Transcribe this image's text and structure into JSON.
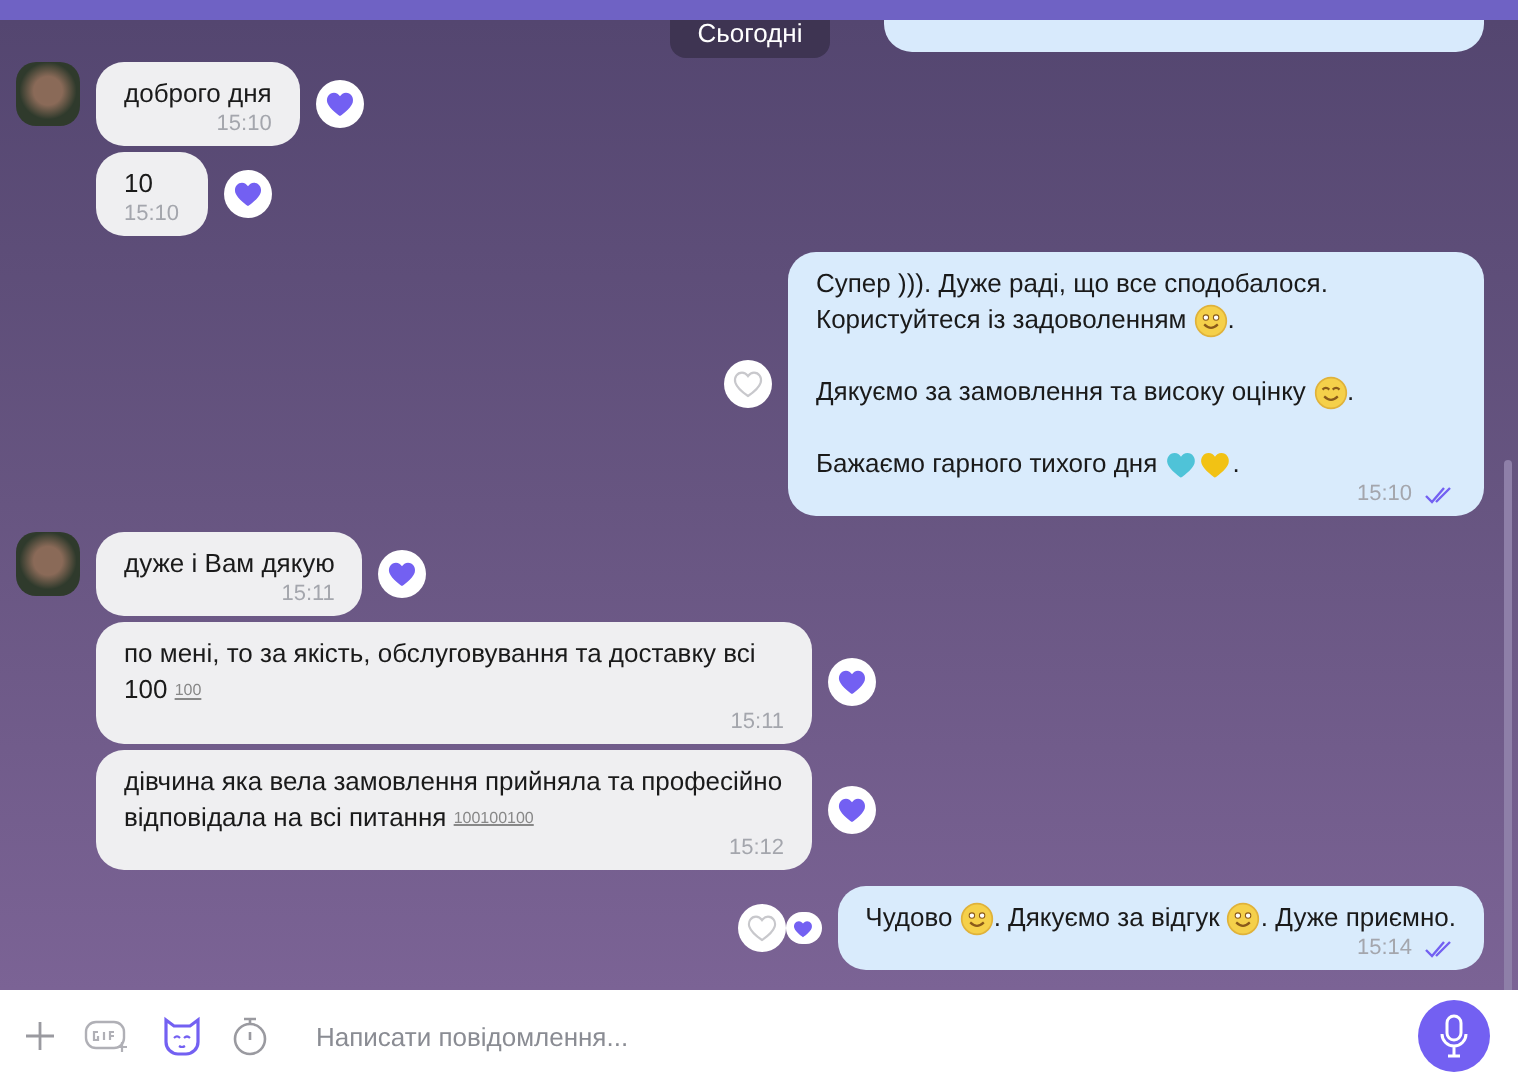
{
  "date_chip": "Сьогодні",
  "messages": [
    {
      "kind": "incoming",
      "avatar": true,
      "parts": [
        {
          "kind": "text",
          "text": "доброго дня"
        }
      ],
      "time": "15:10",
      "reaction": {
        "liked": true
      }
    },
    {
      "kind": "incoming",
      "avatar": false,
      "parts": [
        {
          "kind": "text",
          "text": "10"
        }
      ],
      "time": "15:10",
      "reaction": {
        "liked": true
      }
    },
    {
      "kind": "outgoing",
      "parts": [
        {
          "kind": "text",
          "text": "Супер ))). Дуже раді, що все сподобалося. Користуйтеся із задоволенням "
        },
        {
          "kind": "smile"
        },
        {
          "kind": "text",
          "text": ".\n\nДякуємо за замовлення та високу оцінку "
        },
        {
          "kind": "grin"
        },
        {
          "kind": "text",
          "text": ".\n\nБажаємо гарного тихого дня "
        },
        {
          "kind": "heart",
          "color": "#4fc3d8"
        },
        {
          "kind": "heart",
          "color": "#f2c214"
        },
        {
          "kind": "text",
          "text": "."
        }
      ],
      "time": "15:10",
      "read": true,
      "reaction": {
        "liked": false
      }
    },
    {
      "kind": "incoming",
      "avatar": true,
      "parts": [
        {
          "kind": "text",
          "text": "дуже і Вам дякую"
        }
      ],
      "time": "15:11",
      "reaction": {
        "liked": true
      }
    },
    {
      "kind": "incoming",
      "avatar": false,
      "parts": [
        {
          "kind": "text",
          "text": "по мені, то за якість, обслуговування та доставку всі 100 "
        },
        {
          "kind": "small",
          "text": "100"
        }
      ],
      "time": "15:11",
      "reaction": {
        "liked": true
      }
    },
    {
      "kind": "incoming",
      "avatar": false,
      "parts": [
        {
          "kind": "text",
          "text": "дівчина яка вела замовлення прийняла та професійно відповідала на всі питання "
        },
        {
          "kind": "small",
          "text": "100100100"
        }
      ],
      "time": "15:12",
      "reaction": {
        "liked": true
      }
    },
    {
      "kind": "outgoing",
      "parts": [
        {
          "kind": "text",
          "text": "Чудово "
        },
        {
          "kind": "smile"
        },
        {
          "kind": "text",
          "text": ". Дякуємо за відгук "
        },
        {
          "kind": "smile"
        },
        {
          "kind": "text",
          "text": ". Дуже приємно."
        }
      ],
      "time": "15:14",
      "read": true,
      "reaction": {
        "liked": false,
        "others_liked": true
      }
    }
  ],
  "composer": {
    "placeholder": "Написати повідомлення..."
  }
}
